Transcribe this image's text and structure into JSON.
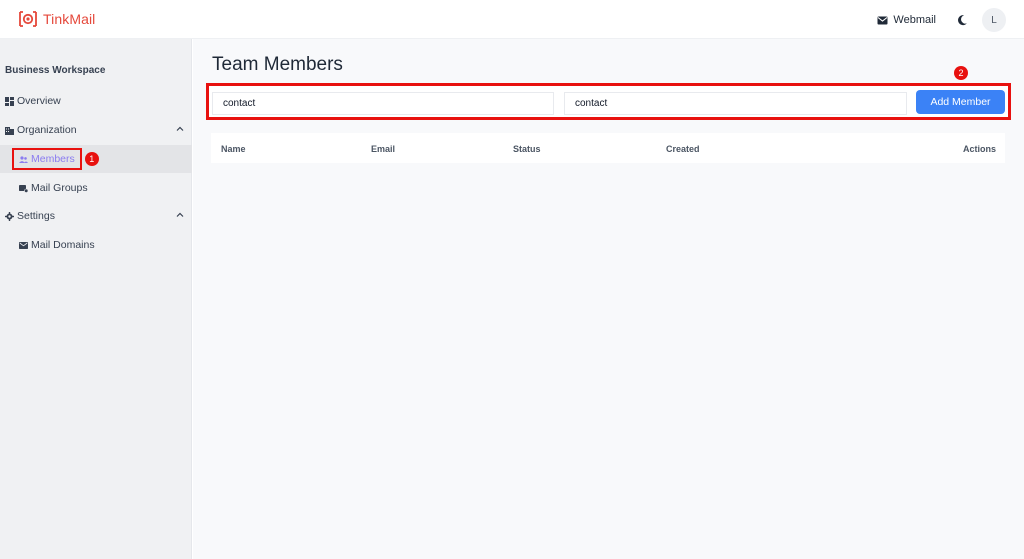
{
  "brand": {
    "name": "TinkMail",
    "color": "#e5483b"
  },
  "header": {
    "webmail_label": "Webmail",
    "avatar_initial": "L",
    "icons": [
      "mail-icon",
      "moon-icon"
    ]
  },
  "sidebar": {
    "workspace_title": "Business Workspace",
    "items": [
      {
        "label": "Overview",
        "icon": "dashboard-icon"
      },
      {
        "label": "Organization",
        "icon": "building-icon",
        "expanded": true
      },
      {
        "label": "Members",
        "icon": "users-icon",
        "active": true
      },
      {
        "label": "Mail Groups",
        "icon": "mail-group-icon"
      },
      {
        "label": "Settings",
        "icon": "gear-icon",
        "expanded": true
      },
      {
        "label": "Mail Domains",
        "icon": "domain-icon"
      }
    ]
  },
  "main": {
    "title": "Team Members",
    "form": {
      "name_value": "contact",
      "email_value": "contact",
      "add_button_label": "Add Member"
    },
    "table": {
      "columns": [
        "Name",
        "Email",
        "Status",
        "Created",
        "Actions"
      ],
      "rows": []
    }
  },
  "annotations": [
    {
      "number": "1"
    },
    {
      "number": "2"
    }
  ],
  "colors": {
    "accent": "#3b82f6",
    "highlight": "#e8110f",
    "active_text": "#8b7cf0"
  }
}
